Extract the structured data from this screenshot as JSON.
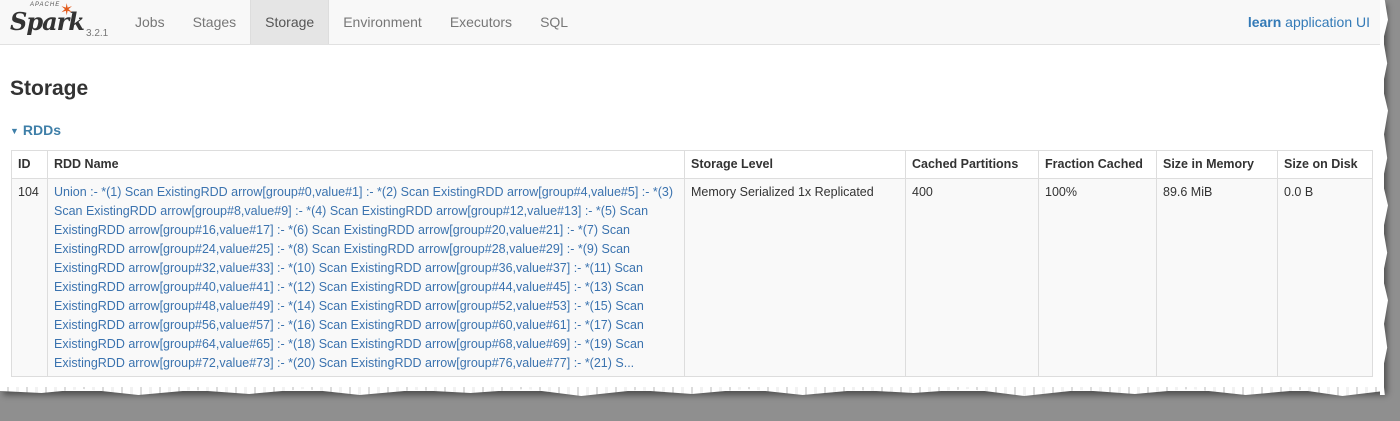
{
  "brand": {
    "apache": "APACHE",
    "name": "Spark",
    "version": "3.2.1",
    "star_color": "#e25a1c"
  },
  "nav": {
    "items": [
      {
        "label": "Jobs"
      },
      {
        "label": "Stages"
      },
      {
        "label": "Storage",
        "active": true
      },
      {
        "label": "Environment"
      },
      {
        "label": "Executors"
      },
      {
        "label": "SQL"
      }
    ],
    "app_name_bold": "learn",
    "app_name_suffix": " application UI"
  },
  "page": {
    "title": "Storage",
    "section_label": "RDDs",
    "toggle_icon": "caret-down-icon"
  },
  "table": {
    "headers": [
      "ID",
      "RDD Name",
      "Storage Level",
      "Cached Partitions",
      "Fraction Cached",
      "Size in Memory",
      "Size on Disk"
    ],
    "rows": [
      {
        "id": "104",
        "name_lines": [
          "Union :- *(1) Scan ExistingRDD arrow[group#0,value#1] :- *(2) Scan ExistingRDD arrow[group#4,value#5] :- *(3)",
          "Scan ExistingRDD arrow[group#8,value#9] :- *(4) Scan ExistingRDD arrow[group#12,value#13] :- *(5) Scan",
          "ExistingRDD arrow[group#16,value#17] :- *(6) Scan ExistingRDD arrow[group#20,value#21] :- *(7) Scan",
          "ExistingRDD arrow[group#24,value#25] :- *(8) Scan ExistingRDD arrow[group#28,value#29] :- *(9) Scan",
          "ExistingRDD arrow[group#32,value#33] :- *(10) Scan ExistingRDD arrow[group#36,value#37] :- *(11) Scan",
          "ExistingRDD arrow[group#40,value#41] :- *(12) Scan ExistingRDD arrow[group#44,value#45] :- *(13) Scan",
          "ExistingRDD arrow[group#48,value#49] :- *(14) Scan ExistingRDD arrow[group#52,value#53] :- *(15) Scan",
          "ExistingRDD arrow[group#56,value#57] :- *(16) Scan ExistingRDD arrow[group#60,value#61] :- *(17) Scan",
          "ExistingRDD arrow[group#64,value#65] :- *(18) Scan ExistingRDD arrow[group#68,value#69] :- *(19) Scan",
          "ExistingRDD arrow[group#72,value#73] :- *(20) Scan ExistingRDD arrow[group#76,value#77] :- *(21) S..."
        ],
        "storage_level": "Memory Serialized 1x Replicated",
        "cached_partitions": "400",
        "fraction_cached": "100%",
        "size_in_memory": "89.6 MiB",
        "size_on_disk": "0.0 B"
      }
    ]
  },
  "colors": {
    "link": "#3b73af",
    "section": "#3f7fa8",
    "navbar_bg": "#f8f8f8",
    "row_bg": "#f9f9f9"
  }
}
